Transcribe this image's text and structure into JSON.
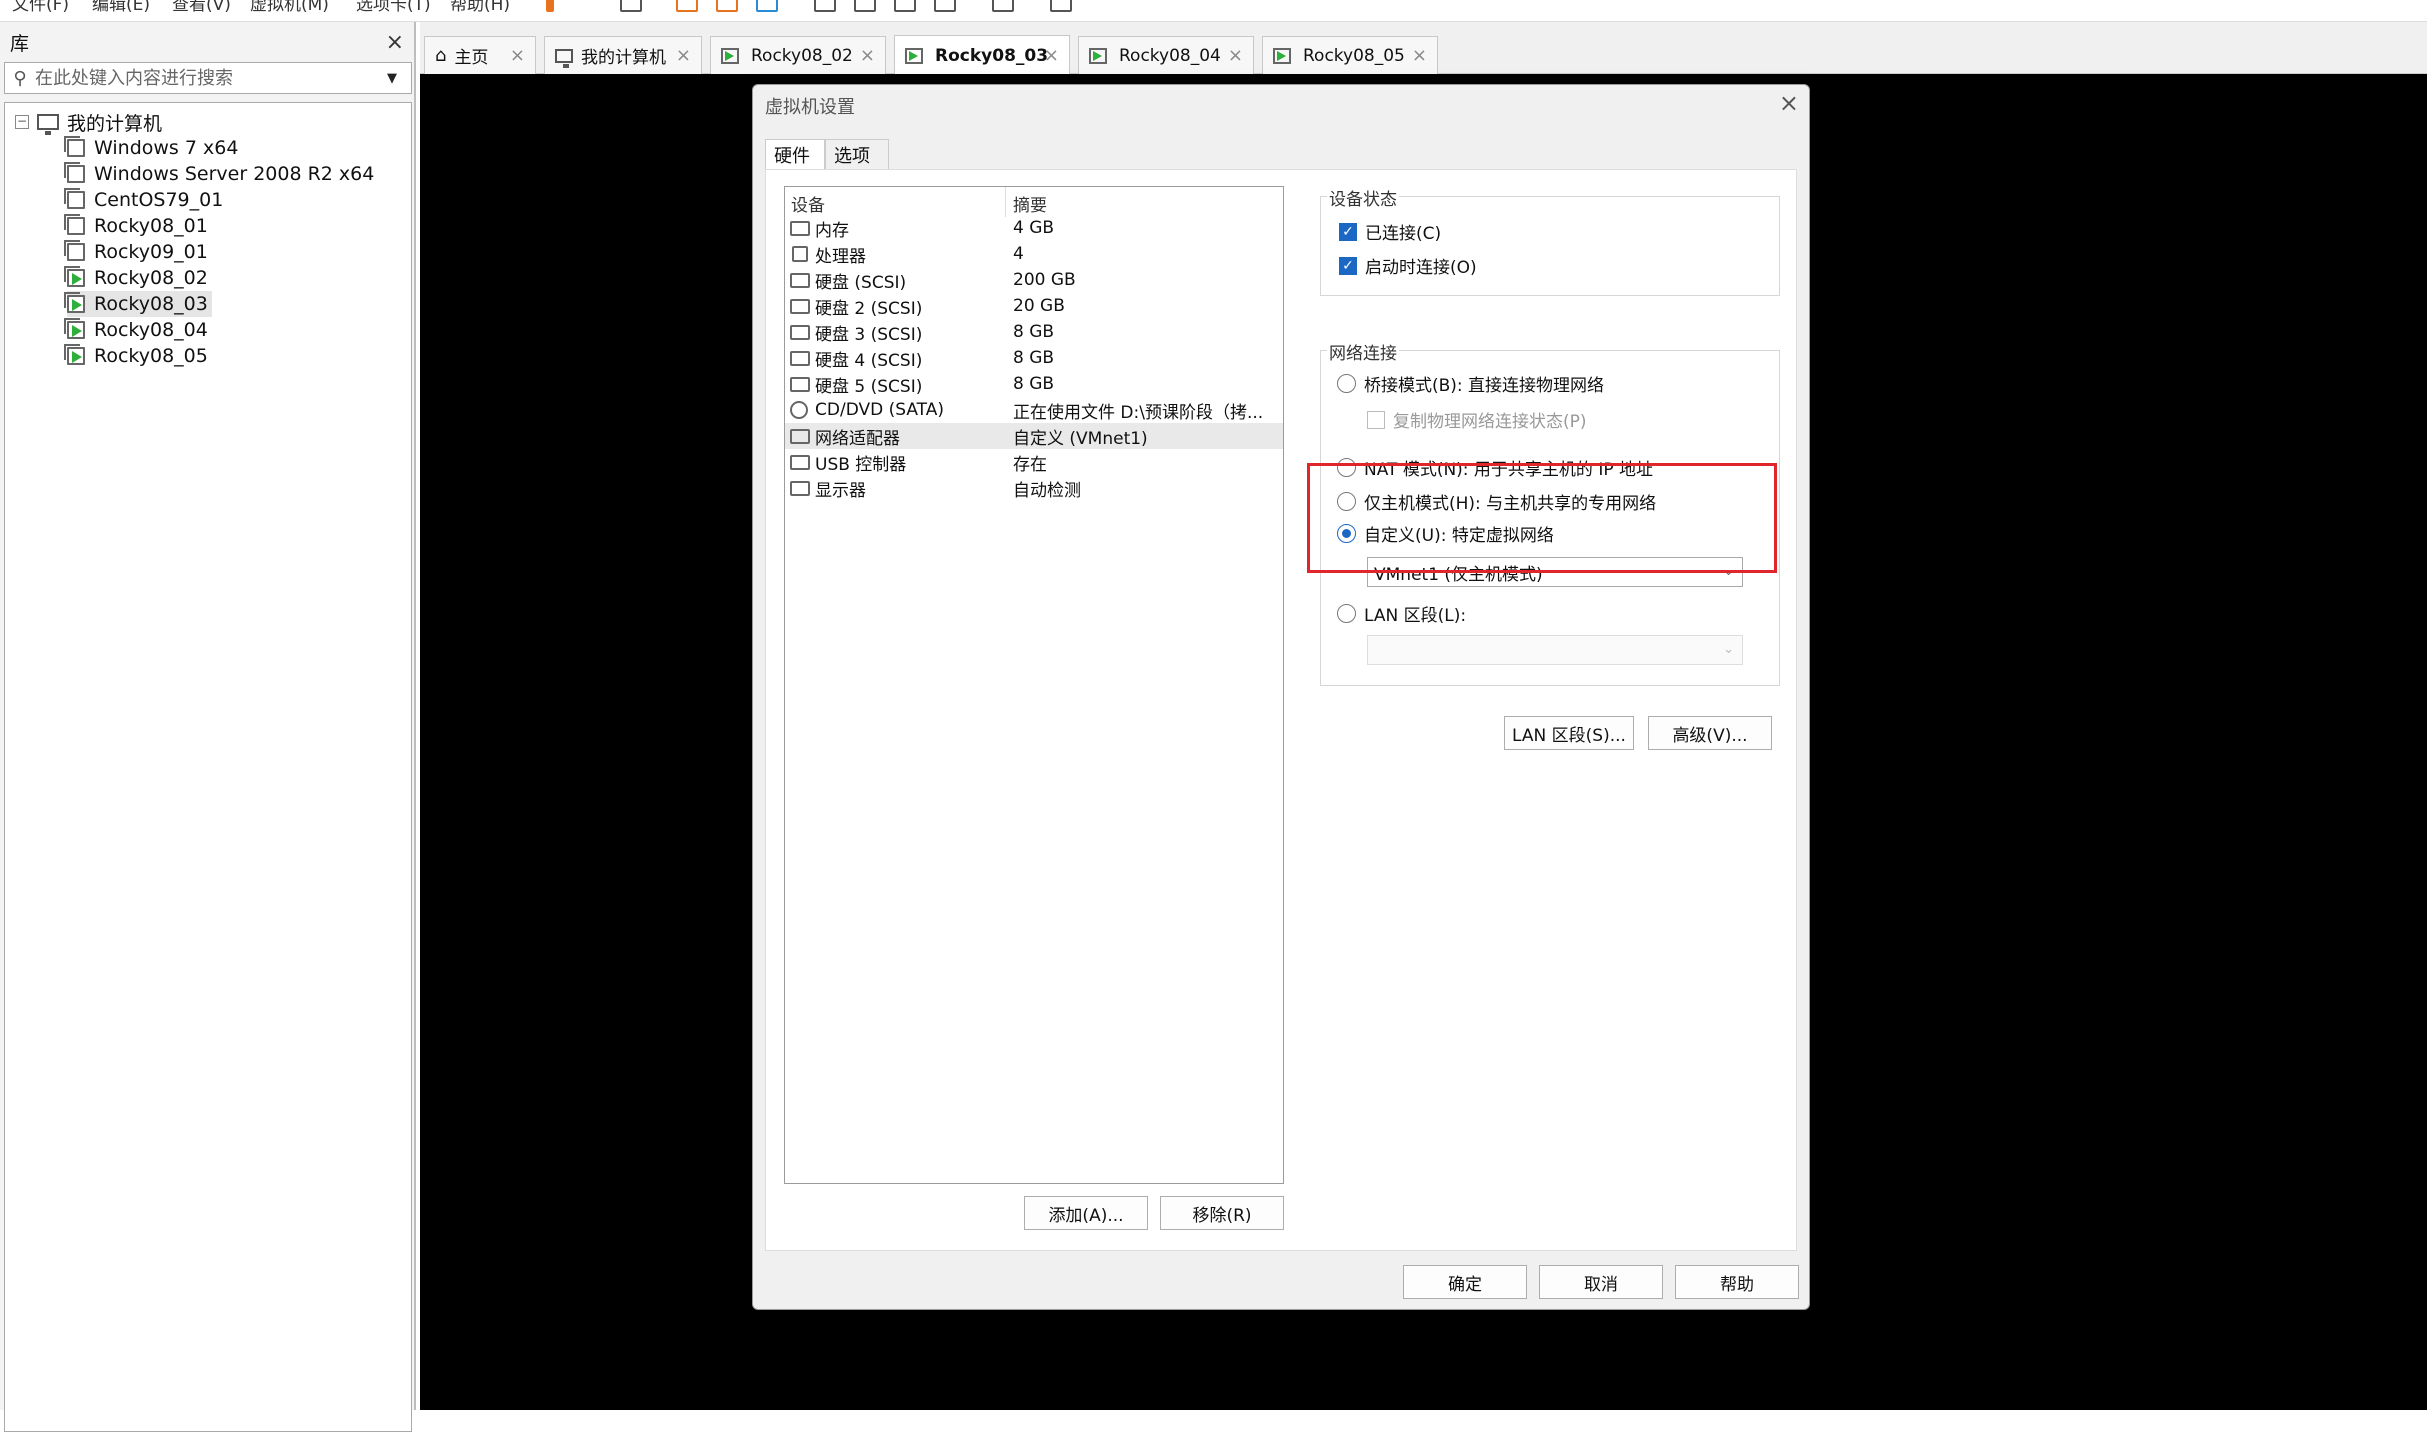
{
  "menu": {
    "items": [
      "文件(F)",
      "编辑(E)",
      "查看(V)",
      "虚拟机(M)",
      "选项卡(T)",
      "帮助(H)"
    ]
  },
  "library": {
    "title": "库",
    "close": "×",
    "search_placeholder": "在此处键入内容进行搜索",
    "root": "我的计算机",
    "vms": [
      {
        "name": "Windows 7 x64",
        "running": false
      },
      {
        "name": "Windows Server 2008 R2 x64",
        "running": false
      },
      {
        "name": "CentOS79_01",
        "running": false
      },
      {
        "name": "Rocky08_01",
        "running": false
      },
      {
        "name": "Rocky09_01",
        "running": false
      },
      {
        "name": "Rocky08_02",
        "running": true
      },
      {
        "name": "Rocky08_03",
        "running": true
      },
      {
        "name": "Rocky08_04",
        "running": true
      },
      {
        "name": "Rocky08_05",
        "running": true
      }
    ]
  },
  "tabs": [
    {
      "label": "主页",
      "active": false
    },
    {
      "label": "我的计算机",
      "active": false
    },
    {
      "label": "Rocky08_02",
      "active": false
    },
    {
      "label": "Rocky08_03",
      "active": true
    },
    {
      "label": "Rocky08_04",
      "active": false
    },
    {
      "label": "Rocky08_05",
      "active": false
    }
  ],
  "dialog": {
    "title": "虚拟机设置",
    "tab_hardware": "硬件",
    "tab_options": "选项",
    "col_device": "设备",
    "col_summary": "摘要",
    "devices": [
      {
        "name": "内存",
        "summary": "4 GB"
      },
      {
        "name": "处理器",
        "summary": "4"
      },
      {
        "name": "硬盘 (SCSI)",
        "summary": "200 GB"
      },
      {
        "name": "硬盘 2 (SCSI)",
        "summary": "20 GB"
      },
      {
        "name": "硬盘 3 (SCSI)",
        "summary": "8 GB"
      },
      {
        "name": "硬盘 4 (SCSI)",
        "summary": "8 GB"
      },
      {
        "name": "硬盘 5 (SCSI)",
        "summary": "8 GB"
      },
      {
        "name": "CD/DVD (SATA)",
        "summary": "正在使用文件 D:\\预课阶段（拷..."
      },
      {
        "name": "网络适配器",
        "summary": "自定义 (VMnet1)"
      },
      {
        "name": "USB 控制器",
        "summary": "存在"
      },
      {
        "name": "显示器",
        "summary": "自动检测"
      }
    ],
    "add_button": "添加(A)...",
    "remove_button": "移除(R)",
    "device_status": {
      "title": "设备状态",
      "connected": "已连接(C)",
      "connect_on_power": "启动时连接(O)"
    },
    "network": {
      "title": "网络连接",
      "bridged": "桥接模式(B): 直接连接物理网络",
      "replicate": "复制物理网络连接状态(P)",
      "nat": "NAT 模式(N): 用于共享主机的 IP 地址",
      "hostonly": "仅主机模式(H): 与主机共享的专用网络",
      "custom": "自定义(U): 特定虚拟网络",
      "custom_select": "VMnet1 (仅主机模式)",
      "lan": "LAN 区段(L):",
      "lan_select": ""
    },
    "lan_button": "LAN 区段(S)...",
    "advanced_button": "高级(V)...",
    "ok": "确定",
    "cancel": "取消",
    "help": "帮助"
  },
  "colors": {
    "accent": "#1a67c4",
    "highlight": "#e0262a",
    "run": "#2eae3a"
  }
}
